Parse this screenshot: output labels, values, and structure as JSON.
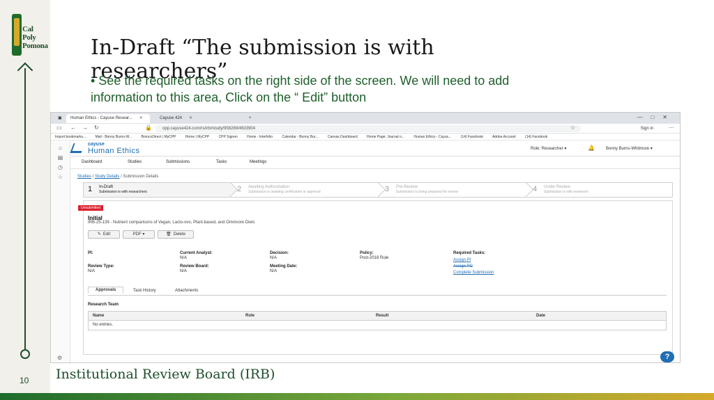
{
  "slide": {
    "title": "In-Draft “The submission is with researchers”",
    "bullet": "• See the required tasks on the right side of the screen. We will need to add information to this area, Click on the “ Edit” button",
    "footer": "Institutional Review Board (IRB)",
    "page_number": "10",
    "logo_text_line1": "Cal Poly",
    "logo_text_line2": "Pomona"
  },
  "browser": {
    "tabs": [
      "Human Ethics - Cayuse Resear...",
      "Cayuse 424"
    ],
    "new_tab": "+",
    "url": "opp.cayuse424.com/rs/irb#study/958289/4633904",
    "signin": "Sign in",
    "bookmarks": [
      "Import bookmarks...",
      "Mail - Bonny Burns-W...",
      "BroncoDirect | MyCPP",
      "Home | MyCPP",
      "CPP Signon",
      "Home - Interfolio",
      "Calendar - Bonny Bur...",
      "Canvas Dashboard",
      "Home Page: Journal o...",
      "Human Ethics - Cayus...",
      "(14) Facebook",
      "Adobe Account",
      "(14) Facebook"
    ]
  },
  "app": {
    "brand_small": "cayuse",
    "brand": "Human Ethics",
    "role": "Role: Researcher ▾",
    "user": "Bonny Burns-Whitmore ▾",
    "nav": [
      "Dashboard",
      "Studies",
      "Submissions",
      "Tasks",
      "Meetings"
    ],
    "breadcrumb": {
      "studies": "Studies",
      "study_details": "Study Details",
      "current": "Submission Details"
    },
    "steps": [
      {
        "num": "1",
        "title": "In-Draft",
        "sub": "Submission is with researchers"
      },
      {
        "num": "2",
        "title": "Awaiting Authorization",
        "sub": "Submission is awaiting certification or approval"
      },
      {
        "num": "3",
        "title": "Pre-Review",
        "sub": "Submission is being prepared for review"
      },
      {
        "num": "4",
        "title": "Under Review",
        "sub": "Submission is with reviewers"
      }
    ],
    "panel": {
      "ribbon": "Unsubmitted",
      "title": "Initial",
      "subtitle": "IRB-25-139 - Nutrient comparisons of Vegan, Lacto-ovo, Plant-based, and Omnivore Diets",
      "buttons": {
        "edit": "Edit",
        "pdf": "PDF ▾",
        "delete": "Delete"
      },
      "fields": {
        "pi_label": "PI:",
        "analyst_label": "Current Analyst:",
        "analyst_value": "N/A",
        "decision_label": "Decision:",
        "decision_value": "N/A",
        "policy_label": "Policy:",
        "policy_value": "Post-2018 Rule",
        "review_type_label": "Review Type:",
        "review_type_value": "N/A",
        "review_board_label": "Review Board:",
        "review_board_value": "N/A",
        "meeting_label": "Meeting Date:",
        "meeting_value": "N/A",
        "tasks_label": "Required Tasks:",
        "tasks": [
          "Assign PI",
          "Assign PC",
          "Complete Submission"
        ]
      },
      "tabs": [
        "Approvals",
        "Task History",
        "Attachments"
      ],
      "research_team": "Research Team",
      "table_headers": [
        "Name",
        "Role",
        "Result",
        "Date"
      ],
      "empty": "No entries."
    },
    "help": "?"
  }
}
